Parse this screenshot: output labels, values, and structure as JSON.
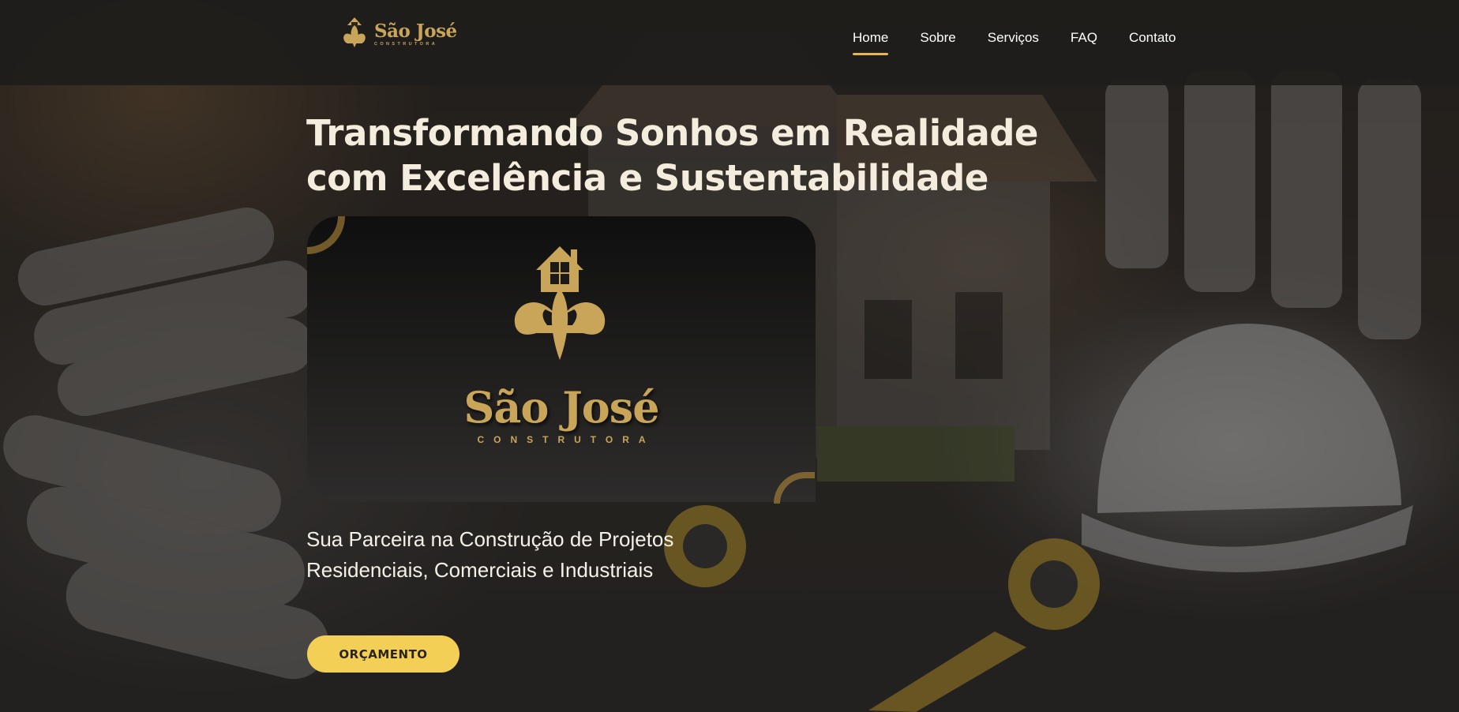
{
  "brand": {
    "name": "São José",
    "subtitle": "CONSTRUTORA",
    "color": "#c9a55a"
  },
  "nav": {
    "items": [
      {
        "label": "Home",
        "active": true
      },
      {
        "label": "Sobre",
        "active": false
      },
      {
        "label": "Serviços",
        "active": false
      },
      {
        "label": "FAQ",
        "active": false
      },
      {
        "label": "Contato",
        "active": false
      }
    ],
    "active_underline_color": "#e4b94a"
  },
  "hero": {
    "title_line1": "Transformando Sonhos em Realidade",
    "title_line2": "com Excelência e Sustentabilidade",
    "card": {
      "name": "São José",
      "subtitle": "CONSTRUTORA",
      "emblem_icon": "fleur-de-lis-house-icon"
    },
    "tagline_line1": "Sua Parceira na Construção de Projetos",
    "tagline_line2": "Residenciais, Comerciais e Industriais",
    "cta_label": "ORÇAMENTO",
    "cta_color": "#f4cf55"
  }
}
